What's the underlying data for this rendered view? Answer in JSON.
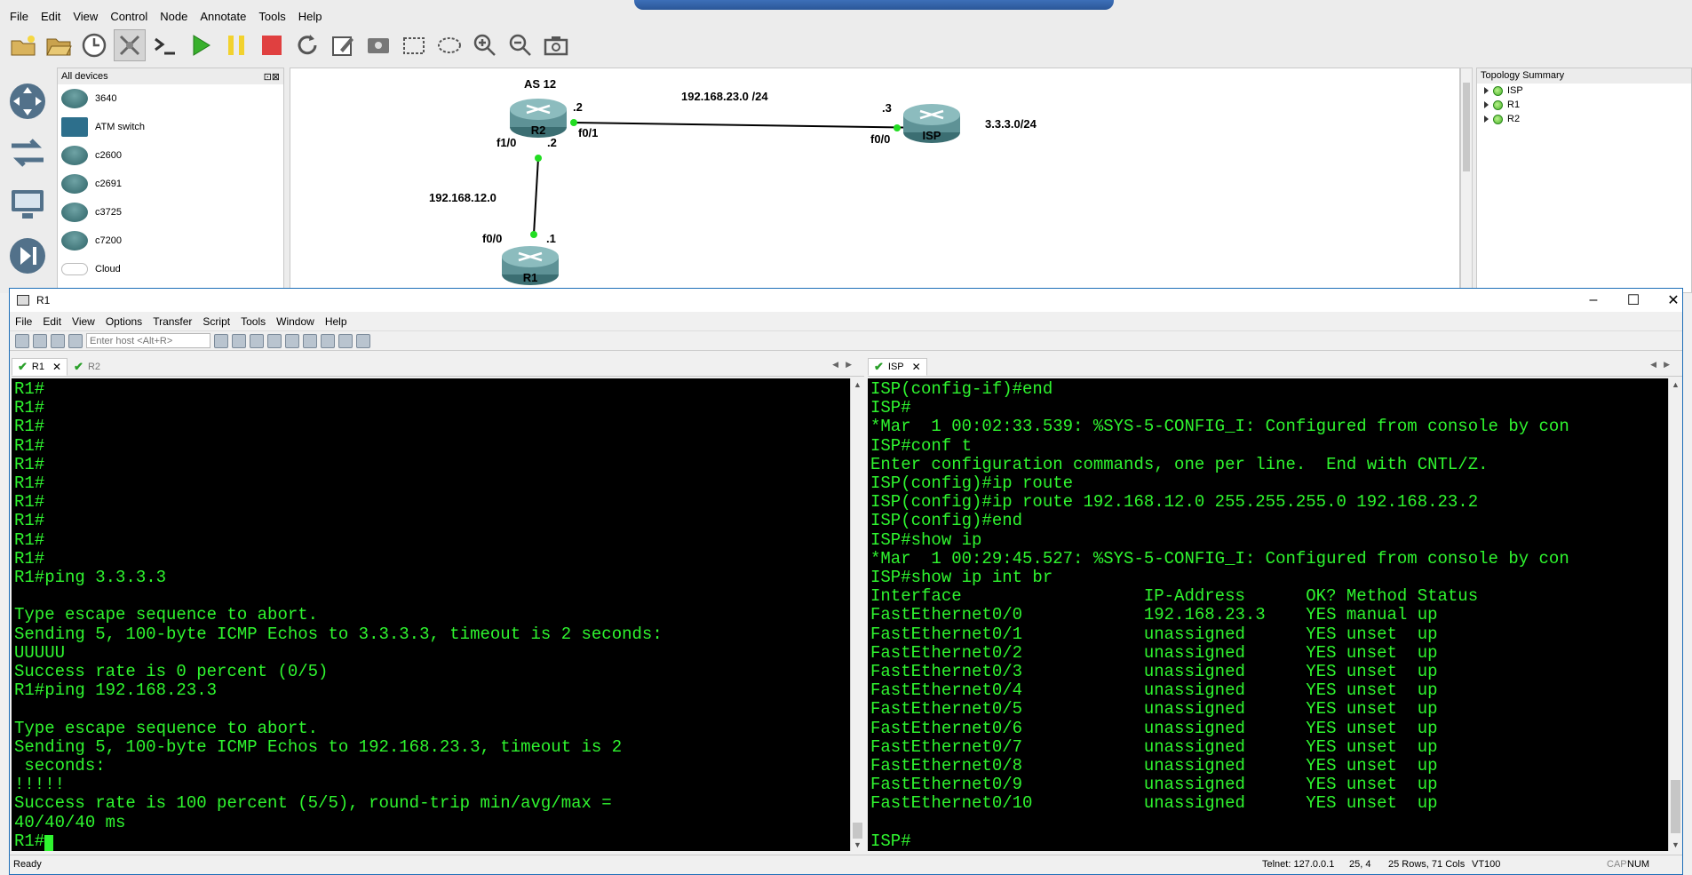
{
  "gns3": {
    "menu": [
      "File",
      "Edit",
      "View",
      "Control",
      "Node",
      "Annotate",
      "Tools",
      "Help"
    ],
    "devices_panel": {
      "title": "All devices",
      "items": [
        "3640",
        "ATM switch",
        "c2600",
        "c2691",
        "c3725",
        "c7200",
        "Cloud"
      ]
    },
    "topology": {
      "as_label": "AS 12",
      "link_r2_isp_net": "192.168.23.0 /24",
      "r2_to_isp_r2_addr": ".2",
      "r2_if": "f0/1",
      "isp_addr": ".3",
      "isp_if": "f0/0",
      "isp_loopback_net": "3.3.3.0/24",
      "r2_f10_if": "f1/0",
      "r2_f10_addr": ".2",
      "link_r1_r2_net": "192.168.12.0",
      "r1_if": "f0/0",
      "r1_addr": ".1",
      "nodes": {
        "r2": "R2",
        "isp": "ISP",
        "r1": "R1"
      },
      "link_status_color": "#22dd22"
    },
    "topology_summary": {
      "title": "Topology Summary",
      "items": [
        "ISP",
        "R1",
        "R2"
      ]
    }
  },
  "crt": {
    "title": "R1",
    "menu": [
      "File",
      "Edit",
      "View",
      "Options",
      "Transfer",
      "Script",
      "Tools",
      "Window",
      "Help"
    ],
    "host_placeholder": "Enter host <Alt+R>",
    "left_tabs": [
      "R1",
      "R2"
    ],
    "right_tabs": [
      "ISP"
    ],
    "left_terminal": [
      "R1#",
      "R1#",
      "R1#",
      "R1#",
      "R1#",
      "R1#",
      "R1#",
      "R1#",
      "R1#",
      "R1#",
      "R1#ping 3.3.3.3",
      "",
      "Type escape sequence to abort.",
      "Sending 5, 100-byte ICMP Echos to 3.3.3.3, timeout is 2 seconds:",
      "UUUUU",
      "Success rate is 0 percent (0/5)",
      "R1#ping 192.168.23.3",
      "",
      "Type escape sequence to abort.",
      "Sending 5, 100-byte ICMP Echos to 192.168.23.3, timeout is 2",
      " seconds:",
      "!!!!!",
      "Success rate is 100 percent (5/5), round-trip min/avg/max =",
      "40/40/40 ms"
    ],
    "left_prompt": "R1#",
    "right_terminal": [
      "ISP(config-if)#end",
      "ISP#",
      "*Mar  1 00:02:33.539: %SYS-5-CONFIG_I: Configured from console by con",
      "ISP#conf t",
      "Enter configuration commands, one per line.  End with CNTL/Z.",
      "ISP(config)#ip route",
      "ISP(config)#ip route 192.168.12.0 255.255.255.0 192.168.23.2",
      "ISP(config)#end",
      "ISP#show ip",
      "*Mar  1 00:29:45.527: %SYS-5-CONFIG_I: Configured from console by con",
      "ISP#show ip int br",
      "Interface                  IP-Address      OK? Method Status",
      "FastEthernet0/0            192.168.23.3    YES manual up",
      "FastEthernet0/1            unassigned      YES unset  up",
      "FastEthernet0/2            unassigned      YES unset  up",
      "FastEthernet0/3            unassigned      YES unset  up",
      "FastEthernet0/4            unassigned      YES unset  up",
      "FastEthernet0/5            unassigned      YES unset  up",
      "FastEthernet0/6            unassigned      YES unset  up",
      "FastEthernet0/7            unassigned      YES unset  up",
      "FastEthernet0/8            unassigned      YES unset  up",
      "FastEthernet0/9            unassigned      YES unset  up",
      "FastEthernet0/10           unassigned      YES unset  up",
      "",
      "ISP#"
    ],
    "status": {
      "left": "Ready",
      "connection": "Telnet: 127.0.0.1",
      "cursor_pos": "25,  4",
      "size": "25 Rows, 71 Cols",
      "emulation": "VT100",
      "caps": "CAP",
      "num": "NUM"
    },
    "terminal_fg": "#2ff52f",
    "terminal_bg": "#000000"
  }
}
